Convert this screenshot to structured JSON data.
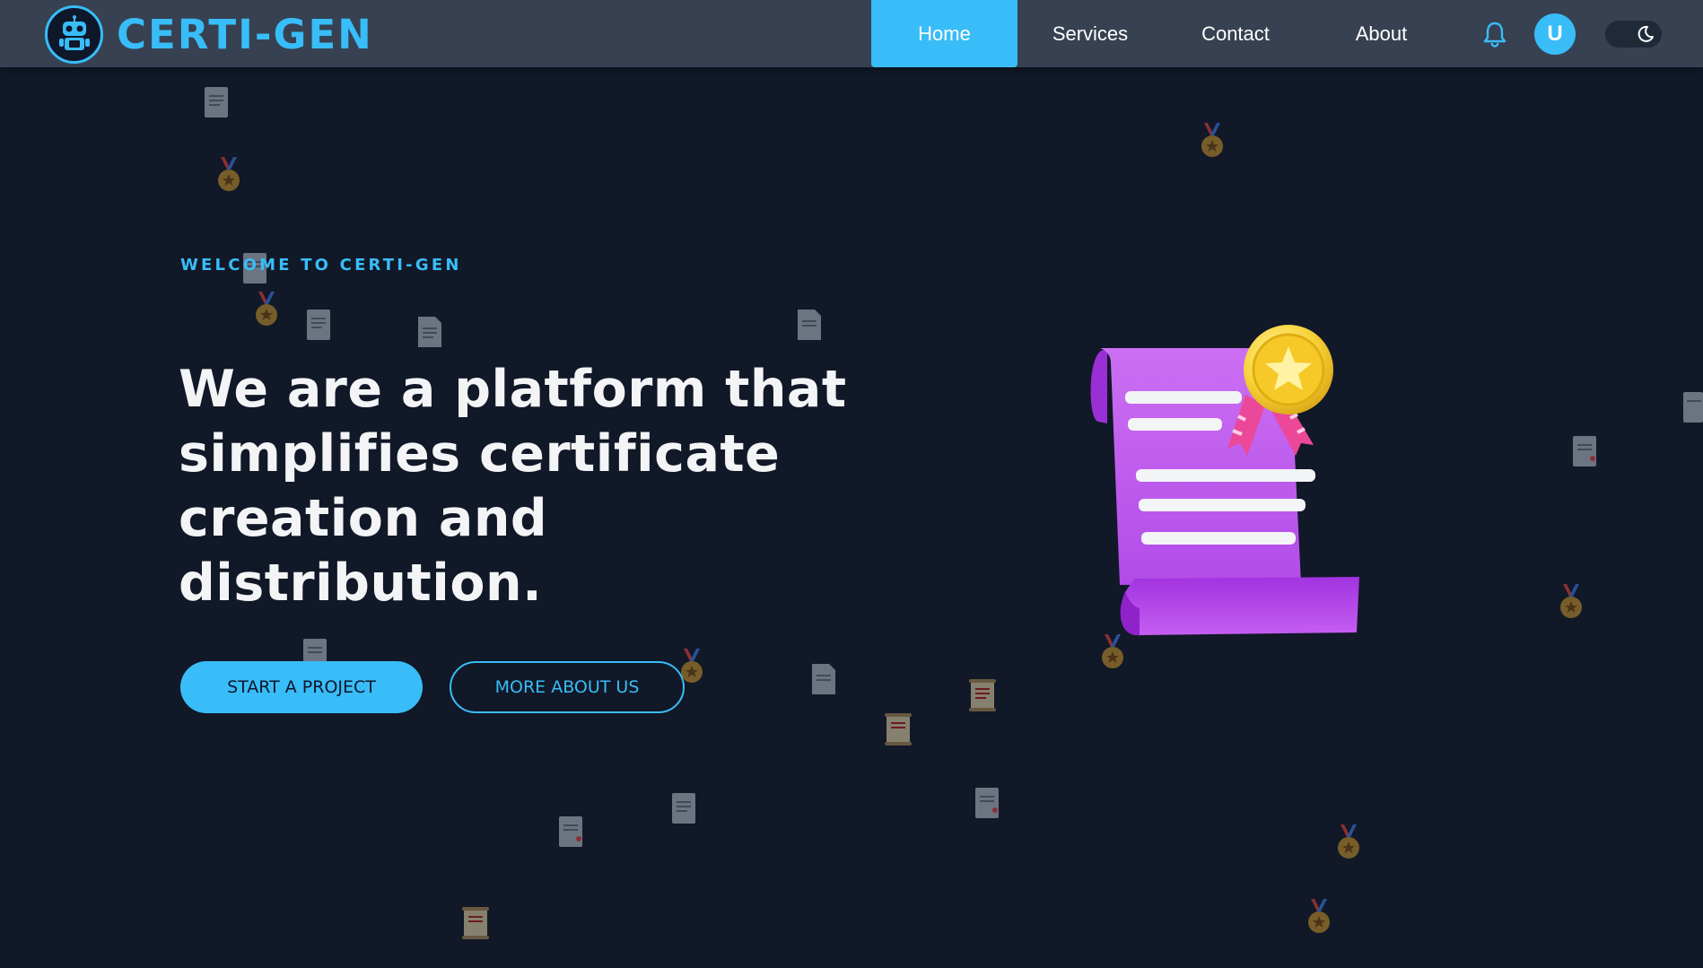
{
  "brand": {
    "name": "CERTI-GEN",
    "logo_icon": "robot-icon",
    "accent_color": "#38bdf8"
  },
  "nav": {
    "items": [
      {
        "label": "Home",
        "active": true
      },
      {
        "label": "Services",
        "active": false
      },
      {
        "label": "Contact",
        "active": false
      },
      {
        "label": "About",
        "active": false
      }
    ],
    "notification_icon": "bell-icon",
    "avatar_initial": "U",
    "theme_toggle_icon": "moon-icon"
  },
  "hero": {
    "eyebrow": "WELCOME TO CERTI-GEN",
    "headline": "We are a platform that simplifies certificate creation and distribution.",
    "primary_button": "START A PROJECT",
    "secondary_button": "MORE ABOUT US",
    "illustration_icon": "certificate-scroll-icon"
  },
  "colors": {
    "background": "#111827",
    "navbar": "#374151",
    "accent": "#38bdf8",
    "certificate": "#c05bf0",
    "medal": "#facc15"
  }
}
